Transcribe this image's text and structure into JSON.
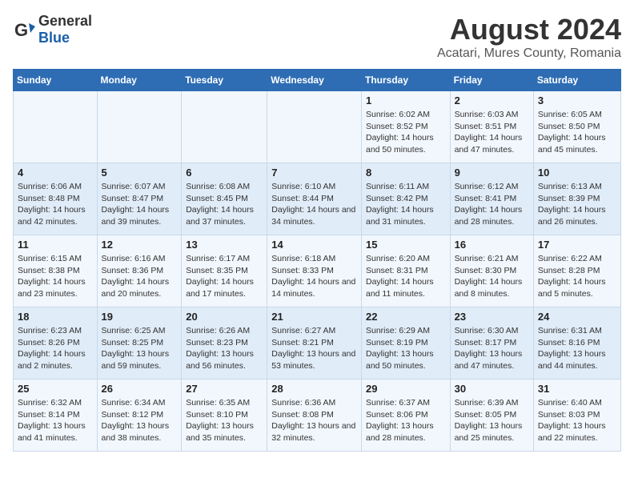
{
  "logo": {
    "general": "General",
    "blue": "Blue"
  },
  "title": "August 2024",
  "subtitle": "Acatari, Mures County, Romania",
  "weekdays": [
    "Sunday",
    "Monday",
    "Tuesday",
    "Wednesday",
    "Thursday",
    "Friday",
    "Saturday"
  ],
  "weeks": [
    [
      {
        "day": "",
        "info": ""
      },
      {
        "day": "",
        "info": ""
      },
      {
        "day": "",
        "info": ""
      },
      {
        "day": "",
        "info": ""
      },
      {
        "day": "1",
        "info": "Sunrise: 6:02 AM\nSunset: 8:52 PM\nDaylight: 14 hours and 50 minutes."
      },
      {
        "day": "2",
        "info": "Sunrise: 6:03 AM\nSunset: 8:51 PM\nDaylight: 14 hours and 47 minutes."
      },
      {
        "day": "3",
        "info": "Sunrise: 6:05 AM\nSunset: 8:50 PM\nDaylight: 14 hours and 45 minutes."
      }
    ],
    [
      {
        "day": "4",
        "info": "Sunrise: 6:06 AM\nSunset: 8:48 PM\nDaylight: 14 hours and 42 minutes."
      },
      {
        "day": "5",
        "info": "Sunrise: 6:07 AM\nSunset: 8:47 PM\nDaylight: 14 hours and 39 minutes."
      },
      {
        "day": "6",
        "info": "Sunrise: 6:08 AM\nSunset: 8:45 PM\nDaylight: 14 hours and 37 minutes."
      },
      {
        "day": "7",
        "info": "Sunrise: 6:10 AM\nSunset: 8:44 PM\nDaylight: 14 hours and 34 minutes."
      },
      {
        "day": "8",
        "info": "Sunrise: 6:11 AM\nSunset: 8:42 PM\nDaylight: 14 hours and 31 minutes."
      },
      {
        "day": "9",
        "info": "Sunrise: 6:12 AM\nSunset: 8:41 PM\nDaylight: 14 hours and 28 minutes."
      },
      {
        "day": "10",
        "info": "Sunrise: 6:13 AM\nSunset: 8:39 PM\nDaylight: 14 hours and 26 minutes."
      }
    ],
    [
      {
        "day": "11",
        "info": "Sunrise: 6:15 AM\nSunset: 8:38 PM\nDaylight: 14 hours and 23 minutes."
      },
      {
        "day": "12",
        "info": "Sunrise: 6:16 AM\nSunset: 8:36 PM\nDaylight: 14 hours and 20 minutes."
      },
      {
        "day": "13",
        "info": "Sunrise: 6:17 AM\nSunset: 8:35 PM\nDaylight: 14 hours and 17 minutes."
      },
      {
        "day": "14",
        "info": "Sunrise: 6:18 AM\nSunset: 8:33 PM\nDaylight: 14 hours and 14 minutes."
      },
      {
        "day": "15",
        "info": "Sunrise: 6:20 AM\nSunset: 8:31 PM\nDaylight: 14 hours and 11 minutes."
      },
      {
        "day": "16",
        "info": "Sunrise: 6:21 AM\nSunset: 8:30 PM\nDaylight: 14 hours and 8 minutes."
      },
      {
        "day": "17",
        "info": "Sunrise: 6:22 AM\nSunset: 8:28 PM\nDaylight: 14 hours and 5 minutes."
      }
    ],
    [
      {
        "day": "18",
        "info": "Sunrise: 6:23 AM\nSunset: 8:26 PM\nDaylight: 14 hours and 2 minutes."
      },
      {
        "day": "19",
        "info": "Sunrise: 6:25 AM\nSunset: 8:25 PM\nDaylight: 13 hours and 59 minutes."
      },
      {
        "day": "20",
        "info": "Sunrise: 6:26 AM\nSunset: 8:23 PM\nDaylight: 13 hours and 56 minutes."
      },
      {
        "day": "21",
        "info": "Sunrise: 6:27 AM\nSunset: 8:21 PM\nDaylight: 13 hours and 53 minutes."
      },
      {
        "day": "22",
        "info": "Sunrise: 6:29 AM\nSunset: 8:19 PM\nDaylight: 13 hours and 50 minutes."
      },
      {
        "day": "23",
        "info": "Sunrise: 6:30 AM\nSunset: 8:17 PM\nDaylight: 13 hours and 47 minutes."
      },
      {
        "day": "24",
        "info": "Sunrise: 6:31 AM\nSunset: 8:16 PM\nDaylight: 13 hours and 44 minutes."
      }
    ],
    [
      {
        "day": "25",
        "info": "Sunrise: 6:32 AM\nSunset: 8:14 PM\nDaylight: 13 hours and 41 minutes."
      },
      {
        "day": "26",
        "info": "Sunrise: 6:34 AM\nSunset: 8:12 PM\nDaylight: 13 hours and 38 minutes."
      },
      {
        "day": "27",
        "info": "Sunrise: 6:35 AM\nSunset: 8:10 PM\nDaylight: 13 hours and 35 minutes."
      },
      {
        "day": "28",
        "info": "Sunrise: 6:36 AM\nSunset: 8:08 PM\nDaylight: 13 hours and 32 minutes."
      },
      {
        "day": "29",
        "info": "Sunrise: 6:37 AM\nSunset: 8:06 PM\nDaylight: 13 hours and 28 minutes."
      },
      {
        "day": "30",
        "info": "Sunrise: 6:39 AM\nSunset: 8:05 PM\nDaylight: 13 hours and 25 minutes."
      },
      {
        "day": "31",
        "info": "Sunrise: 6:40 AM\nSunset: 8:03 PM\nDaylight: 13 hours and 22 minutes."
      }
    ]
  ]
}
